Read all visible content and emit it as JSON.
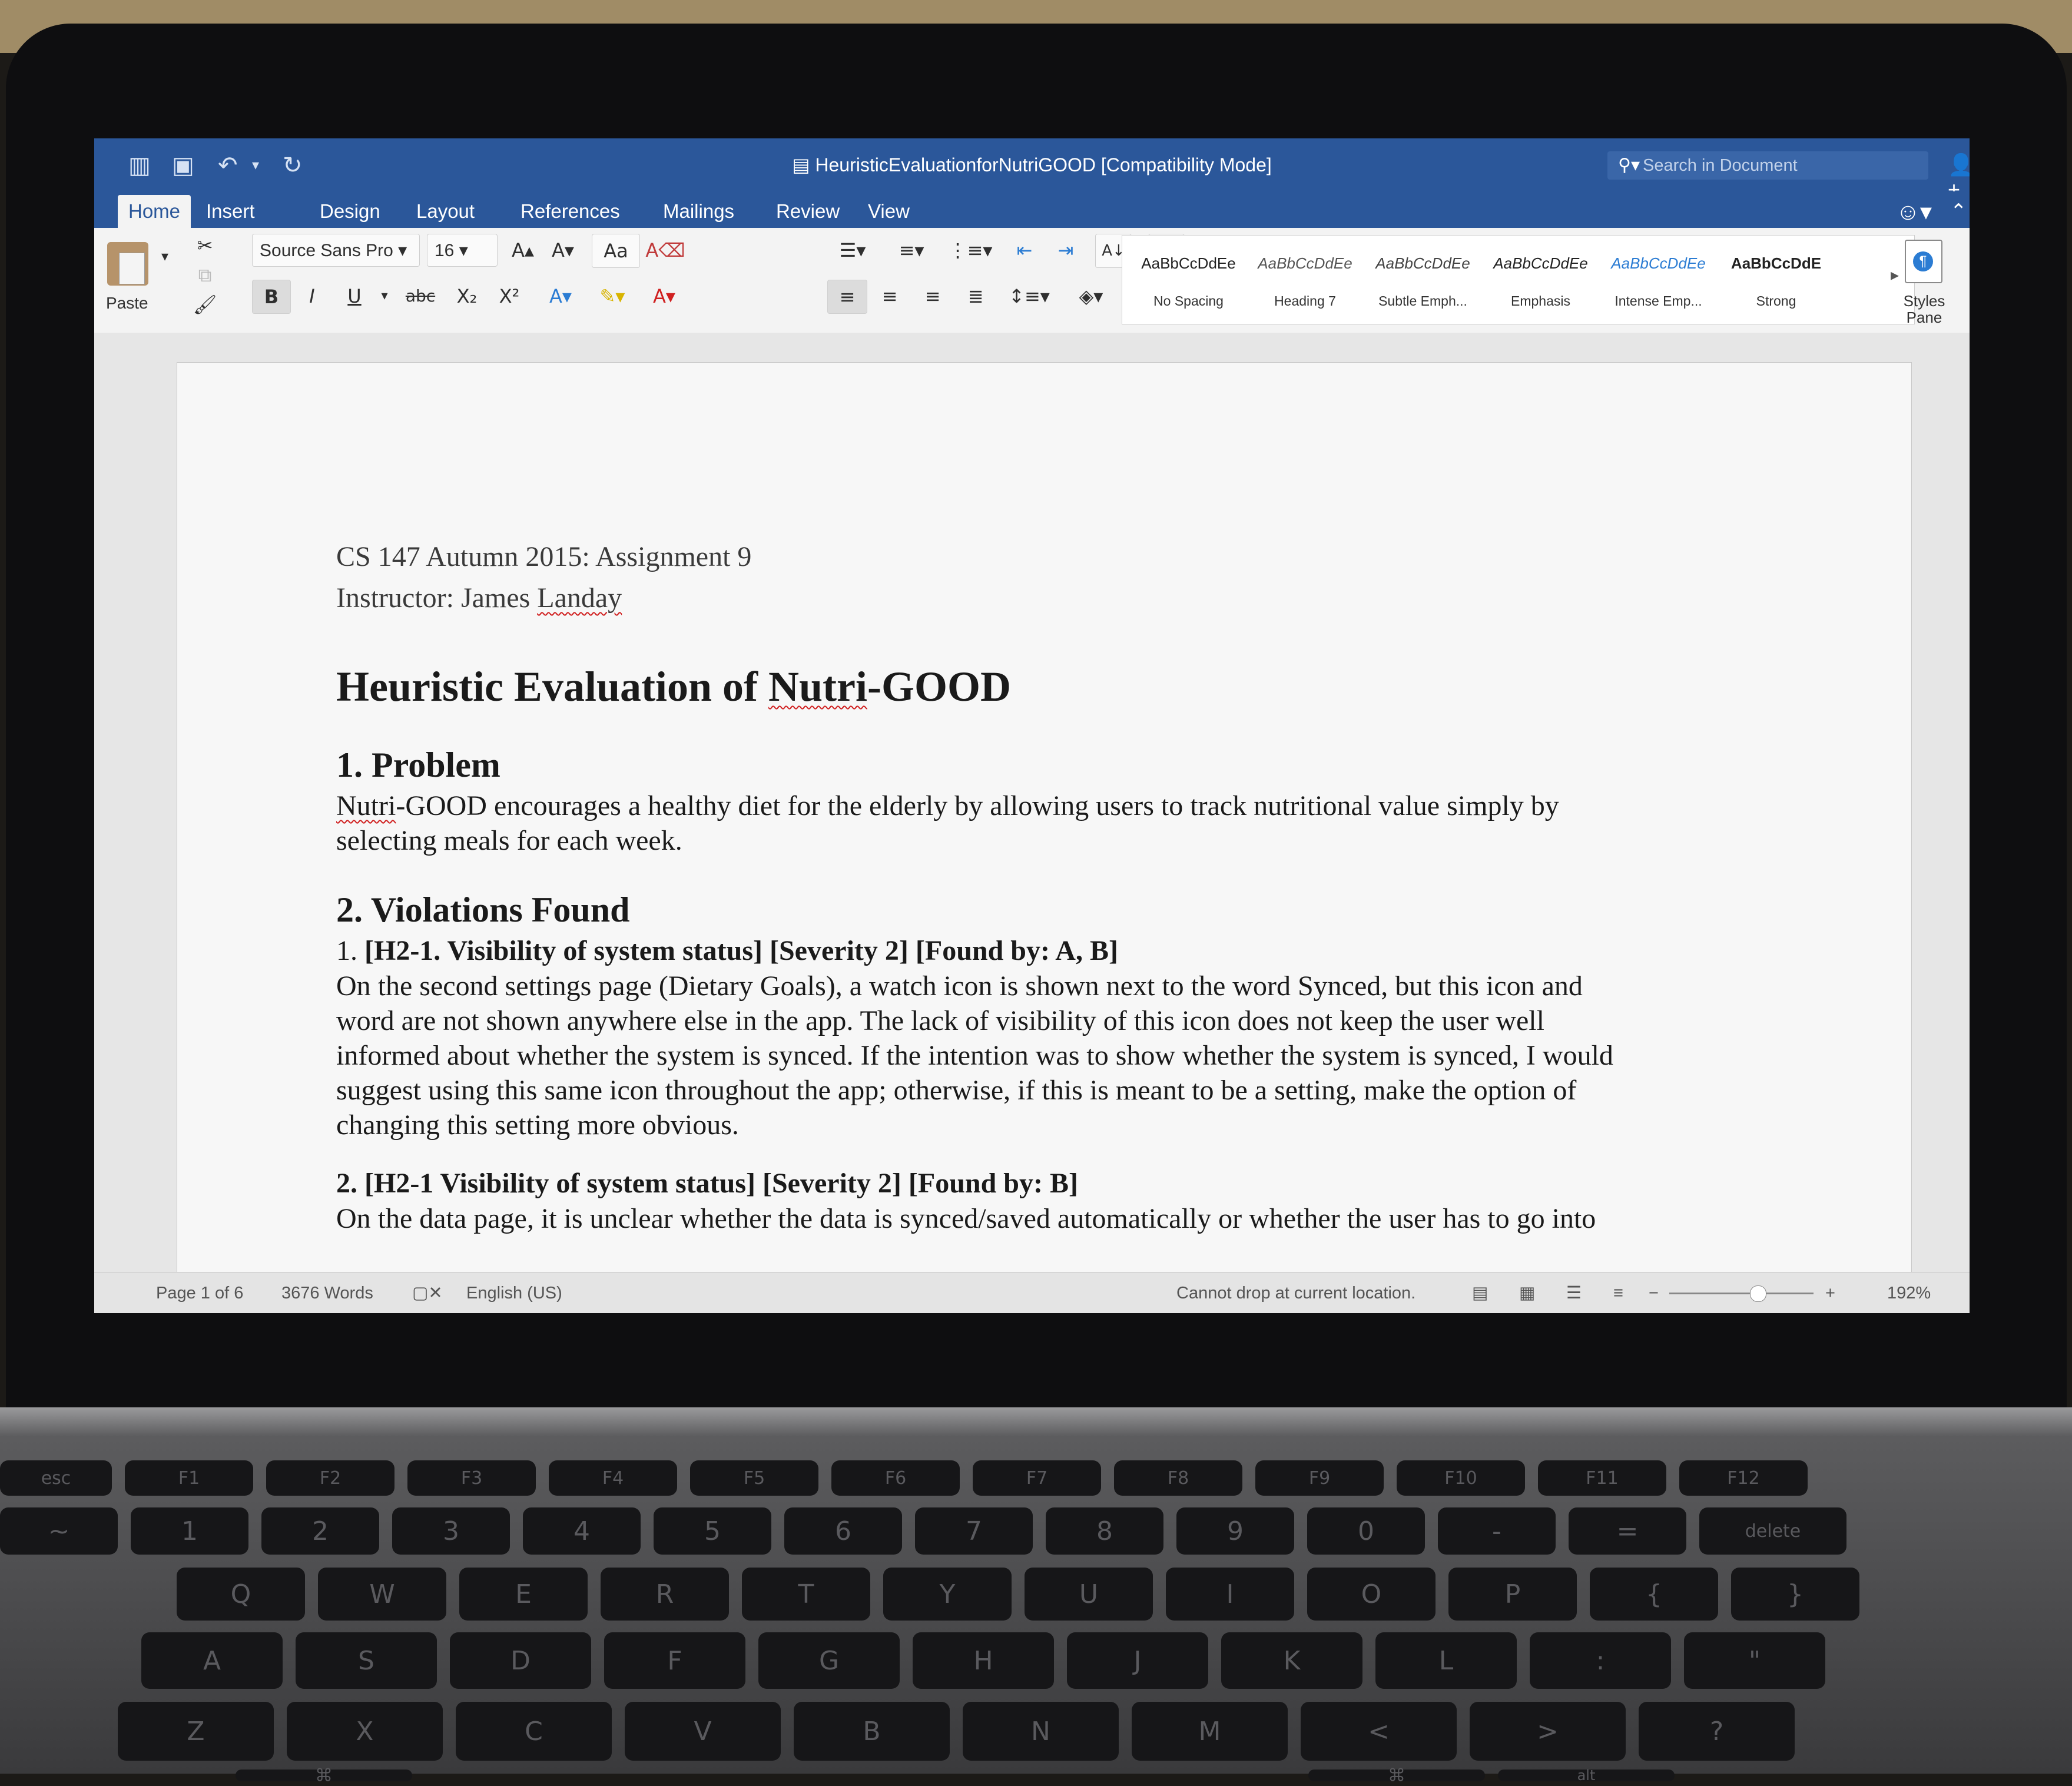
{
  "window": {
    "title": "HeuristicEvaluationforNutriGOOD [Compatibility Mode]",
    "search_placeholder": "Search in Document"
  },
  "quick_access": {
    "sidebar_icon": "sidebar-toggle-icon",
    "save_icon": "save-icon",
    "undo_icon": "undo-icon",
    "redo_icon": "redo-icon"
  },
  "tabs": [
    "Home",
    "Insert",
    "Design",
    "Layout",
    "References",
    "Mailings",
    "Review",
    "View"
  ],
  "ribbon": {
    "paste_label": "Paste",
    "font_name": "Source Sans Pro",
    "font_size": "16",
    "bold": "B",
    "italic": "I",
    "underline": "U",
    "strikethrough": "abc",
    "subscript": "X₂",
    "superscript": "X²",
    "styles": [
      {
        "sample": "AaBbCcDdEe",
        "name": "No Spacing"
      },
      {
        "sample": "AaBbCcDdEe",
        "name": "Heading 7"
      },
      {
        "sample": "AaBbCcDdEe",
        "name": "Subtle Emph..."
      },
      {
        "sample": "AaBbCcDdEe",
        "name": "Emphasis"
      },
      {
        "sample": "AaBbCcDdEe",
        "name": "Intense Emp..."
      },
      {
        "sample": "AaBbCcDdE",
        "name": "Strong"
      }
    ],
    "styles_pane_label_1": "Styles",
    "styles_pane_label_2": "Pane"
  },
  "document": {
    "course_line": "CS 147 Autumn 2015: Assignment 9",
    "instructor_prefix": "Instructor: James ",
    "instructor_name": "Landay",
    "title_prefix": "Heuristic Evaluation of ",
    "title_app": "Nutri",
    "title_suffix": "-GOOD",
    "section1_heading": "1. Problem",
    "section1_first_word": "Nutri",
    "section1_line1": "-GOOD encourages a healthy diet for the elderly by allowing users to track nutritional value simply by",
    "section1_line2": "selecting meals for each week.",
    "section2_heading": "2. Violations Found",
    "item1_number": "1. ",
    "item1_heading": "[H2-1. Visibility of system status] [Severity 2] [Found by: A, B]",
    "item1_lines": [
      "On the second settings page (Dietary Goals), a watch icon is shown next to the word Synced, but this icon and",
      "word are not shown anywhere else in the app. The lack of visibility of this icon does not keep the user well",
      "informed about whether the system is synced. If the intention was to show whether the system is synced, I would",
      "suggest using this same icon throughout the app; otherwise, if this is meant to be a setting, make the option of",
      "changing this setting more obvious."
    ],
    "item2_heading": "2. [H2-1 Visibility of system status] [Severity 2] [Found by: B]",
    "item2_line1": "On the data page, it is unclear whether the data is synced/saved automatically or whether the user has to go into"
  },
  "status": {
    "page": "Page 1 of 6",
    "words": "3676 Words",
    "language": "English (US)",
    "message": "Cannot drop at current location.",
    "zoom_minus": "−",
    "zoom_plus": "+",
    "zoom": "192%"
  },
  "keyboard": {
    "row1": [
      "esc",
      "F1",
      "F2",
      "F3",
      "F4",
      "F5",
      "F6",
      "F7",
      "F8",
      "F9",
      "F10",
      "F11",
      "F12"
    ],
    "row2": [
      "~",
      "1",
      "2",
      "3",
      "4",
      "5",
      "6",
      "7",
      "8",
      "9",
      "0",
      "-",
      "=",
      "delete"
    ],
    "row3": [
      "Q",
      "W",
      "E",
      "R",
      "T",
      "Y",
      "U",
      "I",
      "O",
      "P",
      "{",
      "}"
    ],
    "row4": [
      "A",
      "S",
      "D",
      "F",
      "G",
      "H",
      "J",
      "K",
      "L",
      ":",
      "\""
    ],
    "row5": [
      "Z",
      "X",
      "C",
      "V",
      "B",
      "N",
      "M",
      "<",
      ">",
      "?"
    ],
    "row6": [
      "⌘",
      "⌘",
      "alt"
    ]
  },
  "colors": {
    "titlebar": "#2b579a",
    "ribbon": "#f3f3f3",
    "page": "#f7f7f7",
    "spellcheck": "#d02020"
  }
}
